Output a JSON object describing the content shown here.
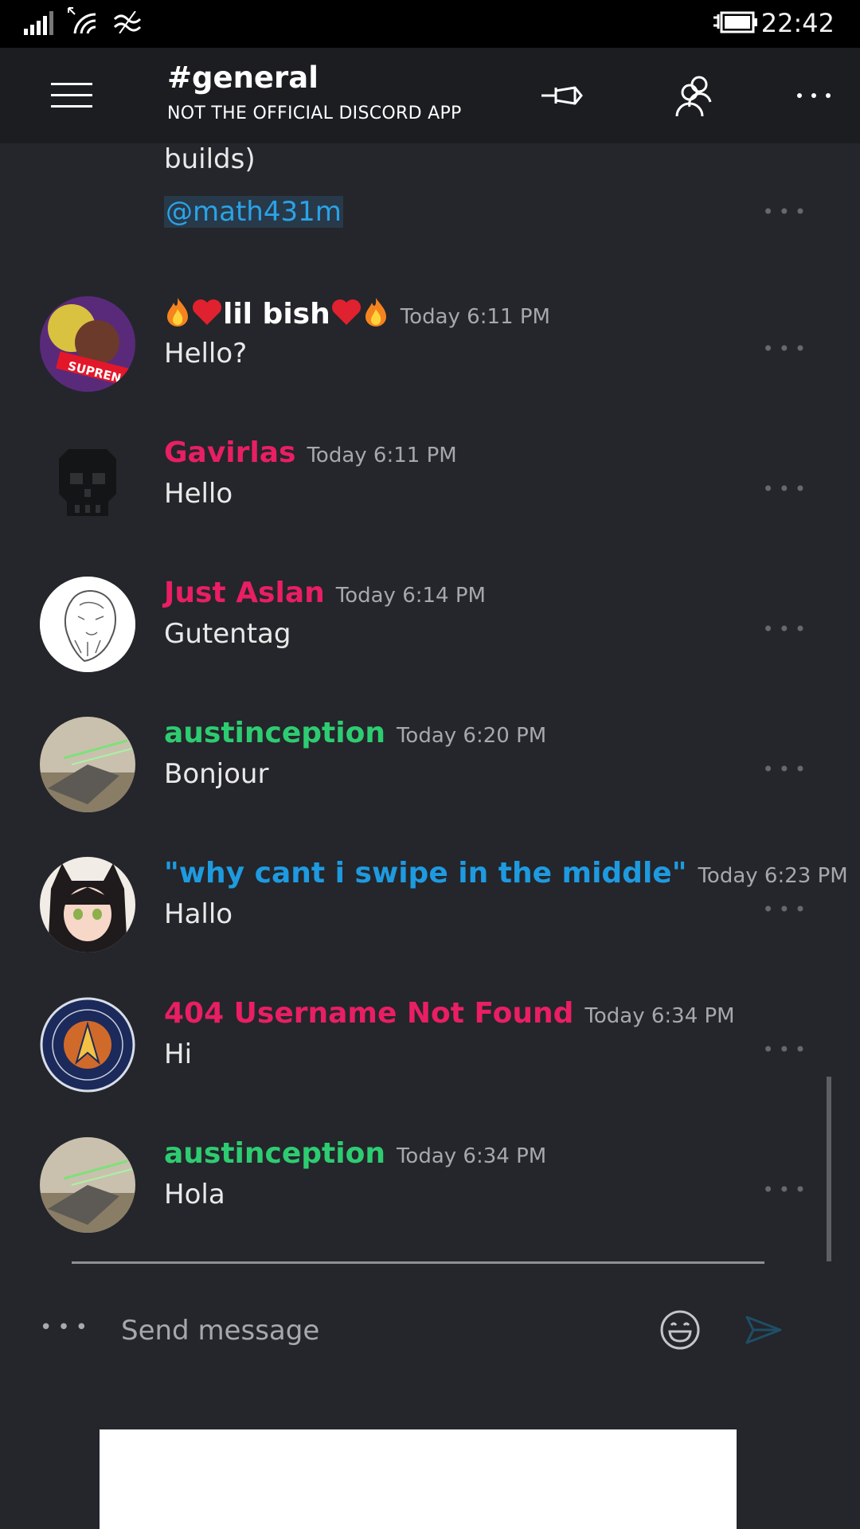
{
  "status_bar": {
    "time": "22:42"
  },
  "header": {
    "channel": "#general",
    "subtitle": "NOT THE OFFICIAL DISCORD APP",
    "icons": [
      "menu-icon",
      "pin-icon",
      "members-icon",
      "more-icon"
    ]
  },
  "partial_message": {
    "text": "builds)",
    "mention": "@math431m"
  },
  "messages": [
    {
      "author": "lil bish",
      "author_color": "#ffffff",
      "time": "Today 6:11 PM",
      "text": "Hello?",
      "avatar": "avatar-supreme"
    },
    {
      "author": "Gavirlas",
      "author_color": "#e91e63",
      "time": "Today 6:11 PM",
      "text": "Hello",
      "avatar": "avatar-skull"
    },
    {
      "author": "Just Aslan",
      "author_color": "#e91e63",
      "time": "Today 6:14 PM",
      "text": "Gutentag",
      "avatar": "avatar-lion"
    },
    {
      "author": "austinception",
      "author_color": "#2ecc71",
      "time": "Today 6:20 PM",
      "text": "Bonjour",
      "avatar": "avatar-falcon"
    },
    {
      "author": "\"why cant i swipe in the middle\"",
      "author_color": "#1e9ae0",
      "time": "Today 6:23 PM",
      "text": "Hallo",
      "avatar": "avatar-anime"
    },
    {
      "author": "404 Username Not Found",
      "author_color": "#e91e63",
      "time": "Today 6:34 PM",
      "text": "Hi",
      "avatar": "avatar-starfleet"
    },
    {
      "author": "austinception",
      "author_color": "#2ecc71",
      "time": "Today 6:34 PM",
      "text": "Hola",
      "avatar": "avatar-falcon"
    }
  ],
  "composer": {
    "placeholder": "Send message"
  }
}
